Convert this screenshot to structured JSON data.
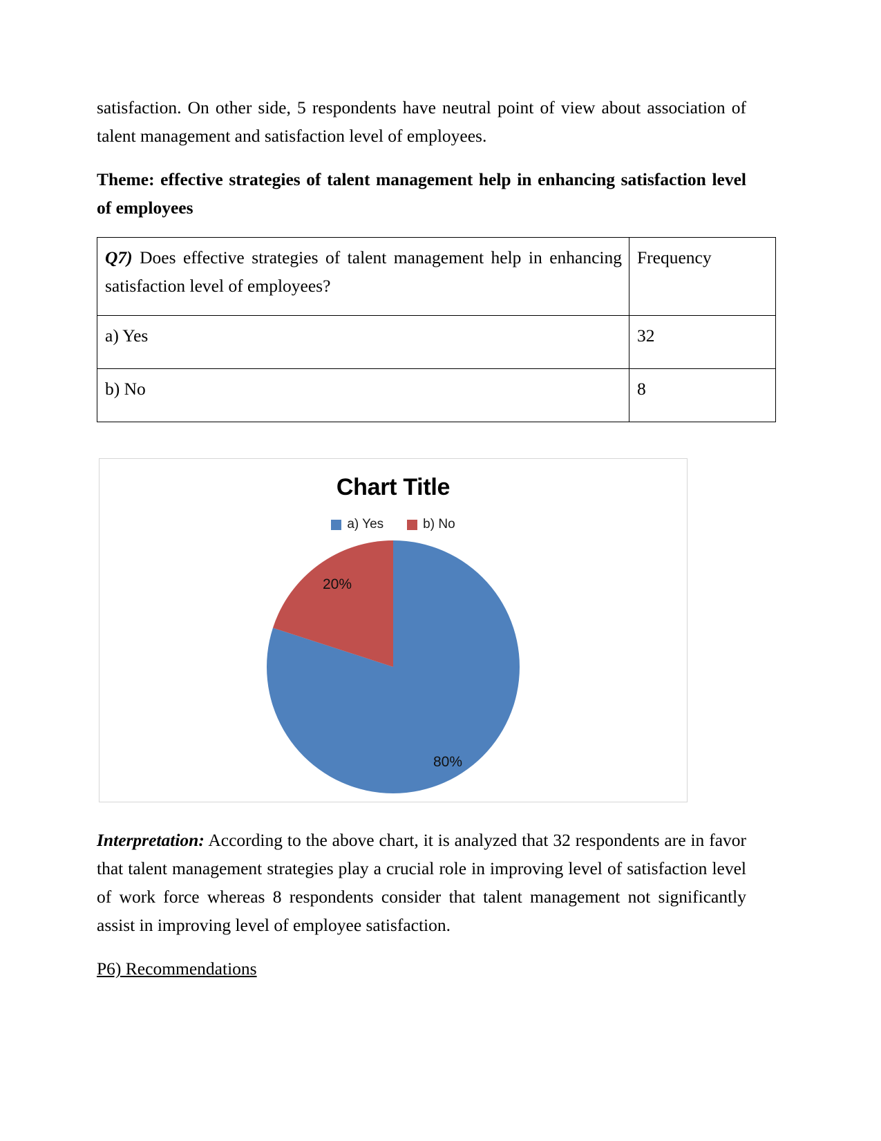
{
  "document": {
    "intro_paragraph": "satisfaction. On other side, 5 respondents have neutral point of view about association of talent management and satisfaction level of employees.",
    "theme_heading": "Theme: effective strategies of talent management help in enhancing satisfaction level of employees",
    "interpretation_label": "Interpretation:",
    "interpretation_text": " According to the above chart, it is analyzed that 32 respondents are in favor that talent management strategies play a crucial role in improving level of satisfaction level of work force whereas 8 respondents consider that talent management not significantly assist in improving level of employee satisfaction.",
    "recommendations_heading": "P6) Recommendations"
  },
  "table": {
    "question_label": "Q7)",
    "question_text": " Does effective strategies of talent management help in enhancing satisfaction level of employees?",
    "frequency_header": "Frequency",
    "rows": [
      {
        "option": "a) Yes",
        "frequency": "32"
      },
      {
        "option": "b) No",
        "frequency": "8"
      }
    ]
  },
  "chart_data": {
    "type": "pie",
    "title": "Chart Title",
    "categories": [
      "a) Yes",
      "b) No"
    ],
    "values": [
      32,
      8
    ],
    "percentages": [
      "80%",
      "20%"
    ],
    "labels": [
      "80%",
      "20%"
    ],
    "colors": [
      "#4F81BD",
      "#C0504D"
    ],
    "legend": [
      "a) Yes",
      "b) No"
    ],
    "legend_position": "top",
    "xlabel": "",
    "ylabel": "",
    "grid": false
  }
}
